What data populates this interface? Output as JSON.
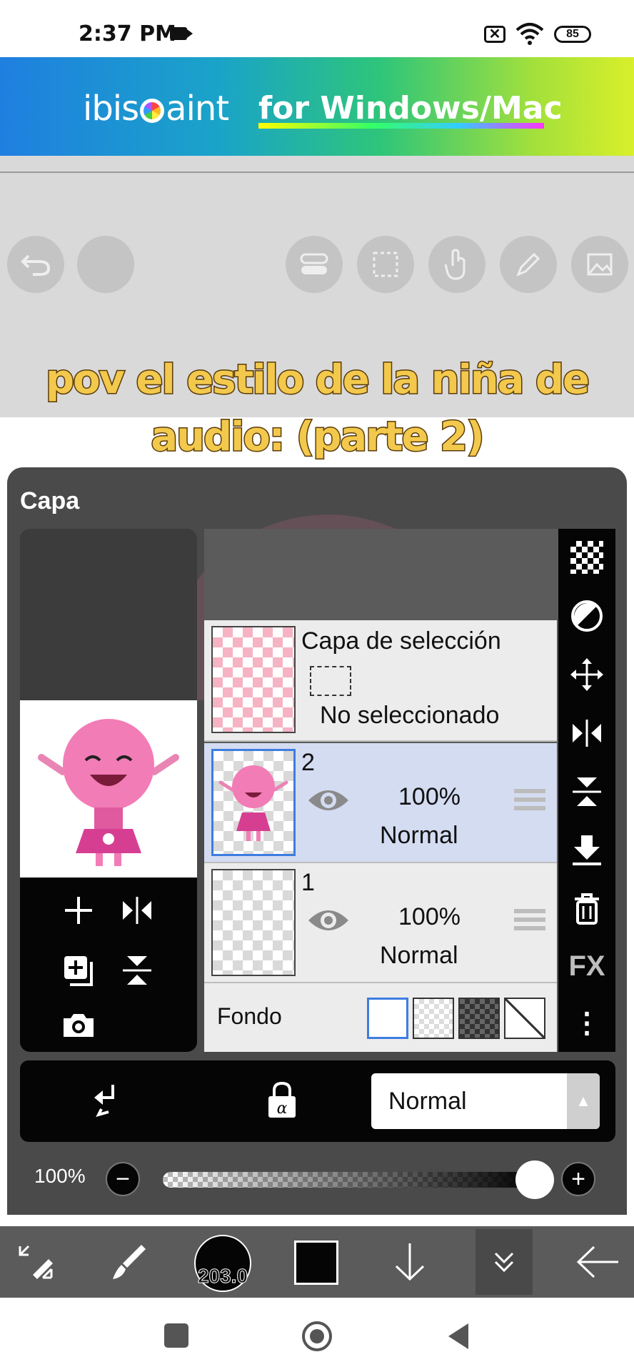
{
  "status_bar": {
    "time": "2:37 PM",
    "battery": "85",
    "mute_glyph": "✕"
  },
  "banner": {
    "brand_left": "ibis",
    "brand_right": "aint",
    "tagline": "for Windows/Mac"
  },
  "caption": {
    "line1": "pov el estilo de la niña de",
    "line2": "audio: (parte 2)"
  },
  "panel": {
    "title": "Capa",
    "selection_layer": {
      "name": "Capa de selección",
      "status": "No seleccionado"
    },
    "layers": [
      {
        "name": "2",
        "opacity": "100%",
        "blend": "Normal",
        "selected": true
      },
      {
        "name": "1",
        "opacity": "100%",
        "blend": "Normal",
        "selected": false
      }
    ],
    "background_label": "Fondo",
    "side_tools": {
      "fx_label": "FX",
      "more_glyph": "⋮"
    },
    "blend_mode": "Normal",
    "opacity_label": "100%",
    "minus": "−",
    "plus": "+"
  },
  "toolbar": {
    "brush_size": "203.0"
  },
  "colors": {
    "accent": "#3d7de0",
    "panel": "#4a4a4a",
    "caption": "#f2c94c"
  },
  "icons": {
    "top": [
      "undo-icon",
      "menu-icon",
      "toggle-icon",
      "select-icon",
      "hand-icon",
      "pen-icon",
      "image-icon"
    ],
    "side": [
      "transparency-icon",
      "invert-icon",
      "move-icon",
      "flip-horizontal-icon",
      "flip-vertical-icon",
      "merge-down-icon",
      "trash-icon"
    ],
    "bottom": [
      "transform-icon",
      "brush-icon",
      "down-arrow-icon",
      "collapse-icon",
      "back-arrow-icon"
    ]
  }
}
